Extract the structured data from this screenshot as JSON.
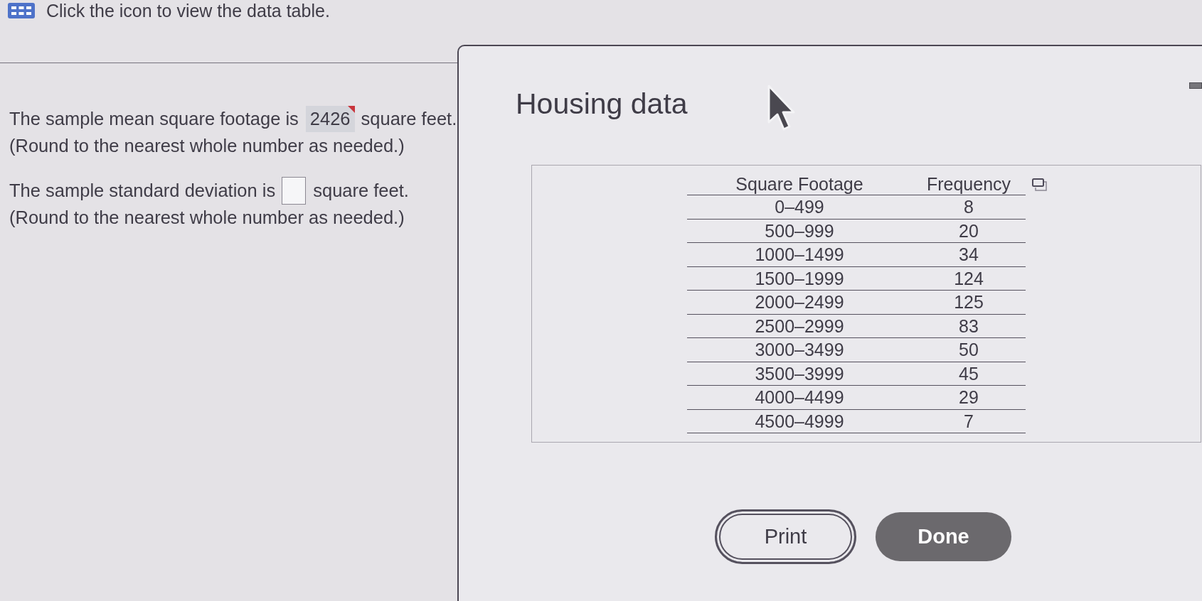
{
  "instruction": {
    "text": "Click the icon to view the data table."
  },
  "questions": [
    {
      "prefix": "The sample mean square footage is",
      "answer": "2426",
      "flagged": true,
      "suffix": "square feet.",
      "note": "(Round to the nearest whole number as needed.)"
    },
    {
      "prefix": "The sample standard deviation is",
      "flagged": false,
      "suffix": "square feet.",
      "note": "(Round to the nearest whole number as needed.)"
    }
  ],
  "dialog": {
    "title": "Housing data",
    "table": {
      "columns": [
        "Square Footage",
        "Frequency"
      ],
      "rows": [
        [
          "0–499",
          "8"
        ],
        [
          "500–999",
          "20"
        ],
        [
          "1000–1499",
          "34"
        ],
        [
          "1500–1999",
          "124"
        ],
        [
          "2000–2499",
          "125"
        ],
        [
          "2500–2999",
          "83"
        ],
        [
          "3000–3499",
          "50"
        ],
        [
          "3500–3999",
          "45"
        ],
        [
          "4000–4499",
          "29"
        ],
        [
          "4500–4999",
          "7"
        ]
      ]
    },
    "buttons": [
      {
        "label": "Print",
        "kind": "secondary"
      },
      {
        "label": "Done",
        "kind": "primary"
      }
    ]
  }
}
